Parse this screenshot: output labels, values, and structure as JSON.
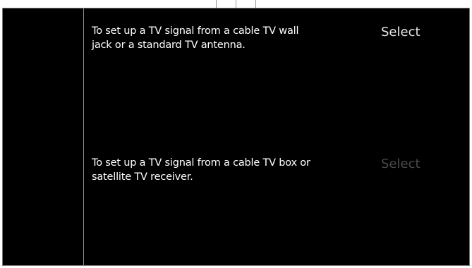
{
  "options": [
    {
      "description": "To set up a TV signal from a cable TV wall jack or a standard TV antenna.",
      "action_label": "Select",
      "state": "highlighted"
    },
    {
      "description": "To set up a TV signal from a cable TV box or satellite TV receiver.",
      "action_label": "Select",
      "state": "dimmed"
    }
  ],
  "colors": {
    "background": "#000000",
    "text": "#ffffff",
    "select_active": "#e6e6e6",
    "select_dim": "#4a4a4a"
  }
}
